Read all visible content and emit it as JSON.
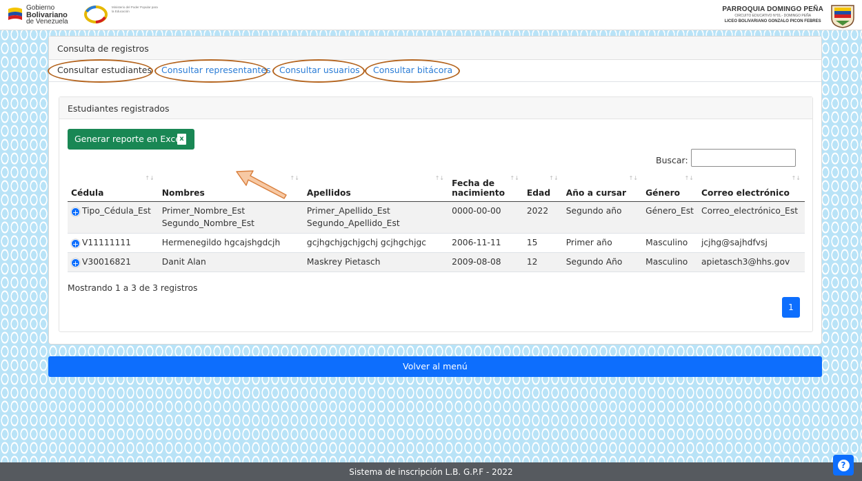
{
  "header": {
    "gov_line1": "Gobierno",
    "gov_line2": "Bolivariano",
    "gov_line3": "de Venezuela",
    "ministry": "Ministerio del Poder Popular para la Educación",
    "school_line1": "PARROQUIA DOMINGO PEÑA",
    "school_line2": "CIRCUITO EDUCATIVO N°01.- DOMINGO PEÑA",
    "school_line3": "LICEO BOLIVARIANO GONZALO PICON FEBRES"
  },
  "card": {
    "title": "Consulta de registros",
    "tabs": [
      {
        "label": "Consultar estudiantes",
        "active": true
      },
      {
        "label": "Consultar representantes",
        "active": false
      },
      {
        "label": "Consultar usuarios",
        "active": false
      },
      {
        "label": "Consultar bitácora",
        "active": false
      }
    ]
  },
  "students": {
    "title": "Estudiantes registrados",
    "excel_button": "Generar reporte en Excel",
    "search_label": "Buscar:",
    "search_value": "",
    "columns": [
      "Cédula",
      "Nombres",
      "Apellidos",
      "Fecha de nacimiento",
      "Edad",
      "Año a cursar",
      "Género",
      "Correo electrónico"
    ],
    "rows": [
      [
        "Tipo_Cédula_Est",
        "Primer_Nombre_Est Segundo_Nombre_Est",
        "Primer_Apellido_Est Segundo_Apellido_Est",
        "0000-00-00",
        "2022",
        "Segundo año",
        "Género_Est",
        "Correo_electrónico_Est"
      ],
      [
        "V11111111",
        "Hermenegildo hgcajshgdcjh",
        "gcjhgchjgchjgchj gcjhgchjgc",
        "2006-11-11",
        "15",
        "Primer año",
        "Masculino",
        "jcjhg@sajhdfvsj"
      ],
      [
        "V30016821",
        "Danit Alan",
        "Maskrey Pietasch",
        "2009-08-08",
        "12",
        "Segundo Año",
        "Masculino",
        "apietasch3@hhs.gov"
      ]
    ],
    "info": "Mostrando 1 a 3 de 3 registros",
    "page": "1"
  },
  "menu_button": "Volver al menú",
  "footer": "Sistema de inscripción L.B. G.P.F - 2022",
  "help_label": "?",
  "colors": {
    "primary": "#0d6efd",
    "excel": "#198754",
    "annotation": "#b4641e"
  }
}
